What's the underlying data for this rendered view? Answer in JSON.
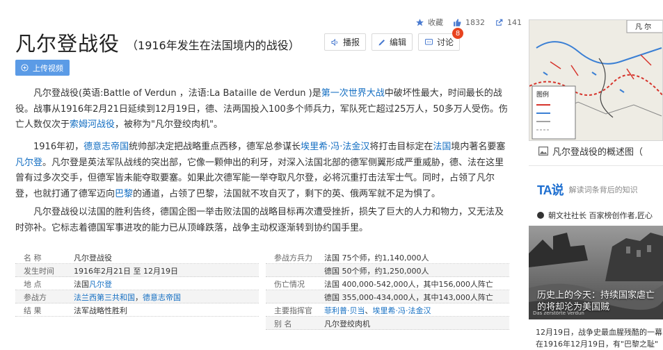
{
  "stats": {
    "favorite_label": "收藏",
    "likes": "1832",
    "shares": "141"
  },
  "title": "凡尔登战役",
  "subtitle": "（1916年发生在法国境内的战役）",
  "toolbar": {
    "broadcast": "播报",
    "edit": "编辑",
    "discuss": "讨论",
    "discuss_badge": "8"
  },
  "upload_label": "上传视频",
  "para1": {
    "p1": "凡尔登战役(英语:Battle of Verdun ，法语:La Bataille de Verdun )是",
    "l1": "第一次世界大战",
    "p2": "中破坏性最大，时间最长的战役。战事从1916年2月21日延续到12月19日，德、法两国投入100多个师兵力，军队死亡超过25万人，50多万人受伤。伤亡人数仅次于",
    "l2": "索姆河战役",
    "p3": "，被称为\"凡尔登绞肉机\"。"
  },
  "para2": {
    "p1": "1916年初，",
    "l1": "德意志帝国",
    "p2": "统帅部决定把战略重点西移，德军总参谋长",
    "l2": "埃里希·冯·法金汉",
    "p3": "将打击目标定在",
    "l3": "法国",
    "p4": "境内著名要塞",
    "l4": "凡尔登",
    "p5": "。凡尔登是英法军队战线的突出部，它像一颗伸出的利牙，对深入法国北部的德军侧翼形成严重威胁，德、法在这里曾有过多次交手，但德军皆未能夺取要塞。如果此次德军能一举夺取凡尔登，必将沉重打击法军士气。同时，占领了凡尔登，也就打通了德军迈向",
    "l5": "巴黎",
    "p6": "的通道，占领了巴黎，法国就不攻自灭了，剩下的英、俄两军就不足为惧了。"
  },
  "para3": "凡尔登战役以法国的胜利告终，德国企图一举击败法国的战略目标再次遭受挫折，损失了巨大的人力和物力，又无法及时弥补。它标志着德国军事进攻的能力已从顶峰跌落，战争主动权逐渐转到协约国手里。",
  "info": {
    "name_k": "名    称",
    "name_v": "凡尔登战役",
    "time_k": "发生时间",
    "time_v": "1916年2月21日 至 12月19日",
    "place_k": "地    点",
    "place_v1": "法国",
    "place_v2": "凡尔登",
    "side_k": "参战方",
    "side_v1": "法兰西第三共和国",
    "side_v2": "，",
    "side_v3": "德意志帝国",
    "result_k": "结    果",
    "result_v": "法军战略性胜利",
    "force_k": "参战方兵力",
    "force_v1": "法国 75个师，约1,140,000人",
    "force_v2": "德国 50个师，约1,250,000人",
    "loss_k": "伤亡情况",
    "loss_v1": "法国 400,000-542,000人，其中156,000人阵亡",
    "loss_v2": "德国 355,000-434,000人，其中143,000人阵亡",
    "cmd_k": "主要指挥官",
    "cmd_v1": "菲利普·贝当",
    "cmd_v2": "、",
    "cmd_v3": "埃里希·冯·法金汉",
    "alias_k": "别    名",
    "alias_v": "凡尔登绞肉机"
  },
  "sidebar": {
    "map_label_top": "凡 尔",
    "map_legend": "图例",
    "map_caption": "凡尔登战役的概述图（",
    "ta_logo": "TA说",
    "ta_sub": "解读词条背后的知识",
    "author": "朝文社社长  百家榜创作者,匠心",
    "photo_title": "历史上的今天：持续国家虐亡的将却沦为美国贼",
    "photo_caption": "Das zerstörte Verdun",
    "text": "12月19日，战争史最血腥残酷的一幕在1916年12月19日，有\"巴黎之耻\""
  },
  "colors": {
    "link": "#136ec2",
    "upload": "#5b9be6",
    "ta": "#1e6fd0",
    "badge": "#e8431f"
  }
}
